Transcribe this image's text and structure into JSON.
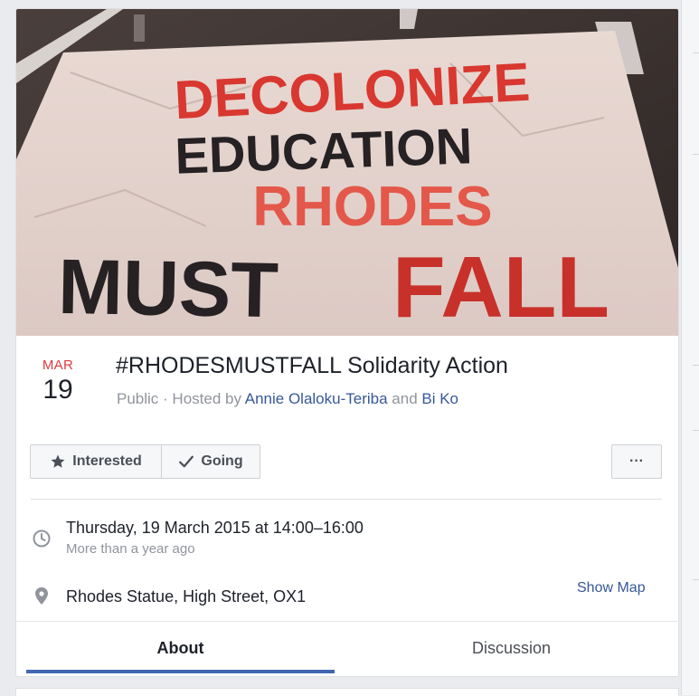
{
  "event": {
    "cover_text": [
      "DECOLONIZE",
      "EDUCATION",
      "RHODES",
      "MUST",
      "FALL"
    ],
    "date_month": "MAR",
    "date_day": "19",
    "title": "#RHODESMUSTFALL Solidarity Action",
    "privacy": "Public",
    "hosted_by_prefix": " · Hosted by ",
    "host_1": "Annie Olaloku-Teriba",
    "host_join": " and ",
    "host_2": "Bi Ko"
  },
  "actions": {
    "interested_label": "Interested",
    "going_label": "Going",
    "more_label": "···"
  },
  "details": {
    "datetime": "Thursday, 19 March 2015 at 14:00–16:00",
    "relative_time": "More than a year ago",
    "location": "Rhodes Statue, High Street, OX1",
    "show_map_label": "Show Map"
  },
  "tabs": [
    {
      "label": "About",
      "active": true
    },
    {
      "label": "Discussion",
      "active": false
    }
  ],
  "colors": {
    "accent": "#4267b2",
    "link": "#365899",
    "date_month": "#e0393e",
    "banner_red": "#d8382f",
    "banner_black": "#262123"
  }
}
